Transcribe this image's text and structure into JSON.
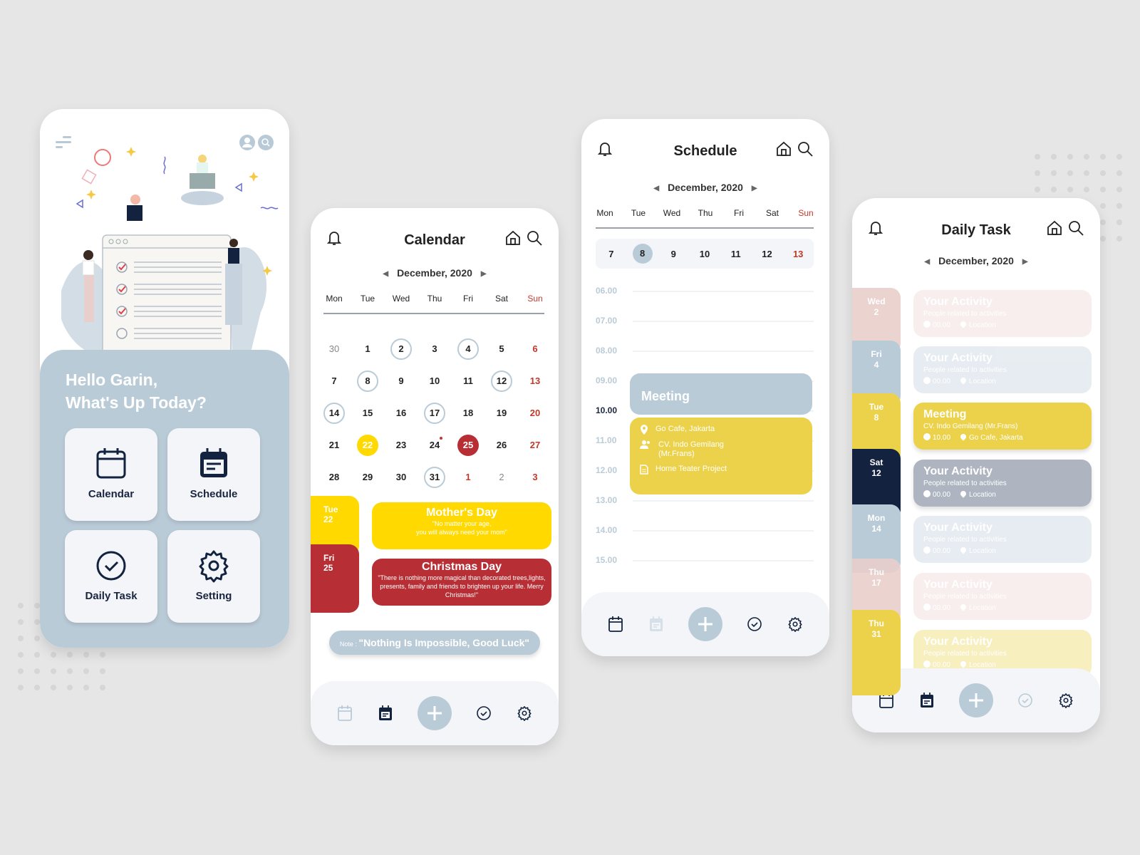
{
  "colors": {
    "background": "#e6e6e6",
    "accent_blue": "#bacbd8",
    "yellow": "#ffd900",
    "mustard": "#ecd24a",
    "dark_red": "#b72f35",
    "navy": "#13233f",
    "pink": "#e9cfcc",
    "gray": "#aeb5c0",
    "sunday_red": "#c0392b"
  },
  "home": {
    "greeting_line1": "Hello Garin,",
    "greeting_line2": "What's Up Today?",
    "tiles": [
      {
        "label": "Calendar",
        "icon": "calendar-icon"
      },
      {
        "label": "Schedule",
        "icon": "schedule-icon"
      },
      {
        "label": "Daily Task",
        "icon": "check-circle-icon"
      },
      {
        "label": "Setting",
        "icon": "gear-icon"
      }
    ]
  },
  "calendar": {
    "title": "Calendar",
    "month": "December, 2020",
    "weekdays": [
      "Mon",
      "Tue",
      "Wed",
      "Thu",
      "Fri",
      "Sat",
      "Sun"
    ],
    "weeks": [
      [
        {
          "d": "30",
          "s": "muted"
        },
        {
          "d": "1"
        },
        {
          "d": "2",
          "s": "ring"
        },
        {
          "d": "3"
        },
        {
          "d": "4",
          "s": "ring"
        },
        {
          "d": "5"
        },
        {
          "d": "6",
          "s": "red"
        }
      ],
      [
        {
          "d": "7"
        },
        {
          "d": "8",
          "s": "ring"
        },
        {
          "d": "9"
        },
        {
          "d": "10"
        },
        {
          "d": "11"
        },
        {
          "d": "12",
          "s": "ring"
        },
        {
          "d": "13",
          "s": "red"
        }
      ],
      [
        {
          "d": "14",
          "s": "ring"
        },
        {
          "d": "15"
        },
        {
          "d": "16"
        },
        {
          "d": "17",
          "s": "ring"
        },
        {
          "d": "18"
        },
        {
          "d": "19"
        },
        {
          "d": "20",
          "s": "red"
        }
      ],
      [
        {
          "d": "21"
        },
        {
          "d": "22",
          "s": "yellow"
        },
        {
          "d": "23"
        },
        {
          "d": "24",
          "s": "dot"
        },
        {
          "d": "25",
          "s": "darkred"
        },
        {
          "d": "26"
        },
        {
          "d": "27",
          "s": "red"
        }
      ],
      [
        {
          "d": "28"
        },
        {
          "d": "29"
        },
        {
          "d": "30"
        },
        {
          "d": "31",
          "s": "ring"
        },
        {
          "d": "1",
          "s": "red"
        },
        {
          "d": "2",
          "s": "muted"
        },
        {
          "d": "3",
          "s": "red"
        }
      ]
    ],
    "events": [
      {
        "day": "Tue",
        "date": "22",
        "title": "Mother's Day",
        "quote": "\"No matter your age,\nyou will always need your mom\""
      },
      {
        "day": "Fri",
        "date": "25",
        "title": "Christmas Day",
        "quote": "\"There is nothing more magical than decorated trees,lights, presents, family and friends to brighten up your life. Merry Christmas!\""
      }
    ],
    "note_label": "Note : ",
    "note_text": "\"Nothing Is Impossible, Good Luck\""
  },
  "schedule": {
    "title": "Schedule",
    "month": "December, 2020",
    "weekdays": [
      "Mon",
      "Tue",
      "Wed",
      "Thu",
      "Fri",
      "Sat",
      "Sun"
    ],
    "week_dates": [
      "7",
      "8",
      "9",
      "10",
      "11",
      "12",
      "13"
    ],
    "selected_date": "8",
    "hours": [
      "06.00",
      "07.00",
      "08.00",
      "09.00",
      "10.00",
      "11.00",
      "12.00",
      "13.00",
      "14.00",
      "15.00"
    ],
    "current_hour": "10.00",
    "event": {
      "title": "Meeting",
      "location": "Go Cafe, Jakarta",
      "people": "CV. Indo Gemilang\n(Mr.Frans)",
      "project": "Home Teater Project"
    }
  },
  "daily_task": {
    "title": "Daily Task",
    "month": "December, 2020",
    "days": [
      {
        "day": "Wed",
        "date": "2",
        "color": "#e9cfcc"
      },
      {
        "day": "Fri",
        "date": "4",
        "color": "#bacbd8"
      },
      {
        "day": "Tue",
        "date": "8",
        "color": "#ecd24a"
      },
      {
        "day": "Sat",
        "date": "12",
        "color": "#13233f"
      },
      {
        "day": "Mon",
        "date": "14",
        "color": "#bacbd8"
      },
      {
        "day": "Thu",
        "date": "17",
        "color": "#e9cfcc"
      },
      {
        "day": "Thu",
        "date": "31",
        "color": "#ecd24a"
      }
    ],
    "tasks": [
      {
        "title": "Your Activity",
        "sub": "People related to activities",
        "time": "00.00",
        "loc": "Location",
        "color": "#e9cfcc",
        "faded": true
      },
      {
        "title": "Your Activity",
        "sub": "People related to activities",
        "time": "00.00",
        "loc": "Location",
        "color": "#bacbd8",
        "faded": true
      },
      {
        "title": "Meeting",
        "sub": "CV. Indo Gemilang (Mr.Frans)",
        "time": "10.00",
        "loc": "Go Cafe, Jakarta",
        "color": "#ecd24a",
        "faded": false
      },
      {
        "title": "Your Activity",
        "sub": "People related to activities",
        "time": "00.00",
        "loc": "Location",
        "color": "#aeb5c0",
        "faded": false
      },
      {
        "title": "Your Activity",
        "sub": "People related to activities",
        "time": "00.00",
        "loc": "Location",
        "color": "#bacbd8",
        "faded": true
      },
      {
        "title": "Your Activity",
        "sub": "People related to activities",
        "time": "00.00",
        "loc": "Location",
        "color": "#e9cfcc",
        "faded": true
      },
      {
        "title": "Your Activity",
        "sub": "People related to activities",
        "time": "00.00",
        "loc": "Location",
        "color": "#ecd24a",
        "faded": true
      }
    ]
  },
  "nav_items": [
    "calendar",
    "schedule",
    "add",
    "daily-task",
    "setting"
  ]
}
